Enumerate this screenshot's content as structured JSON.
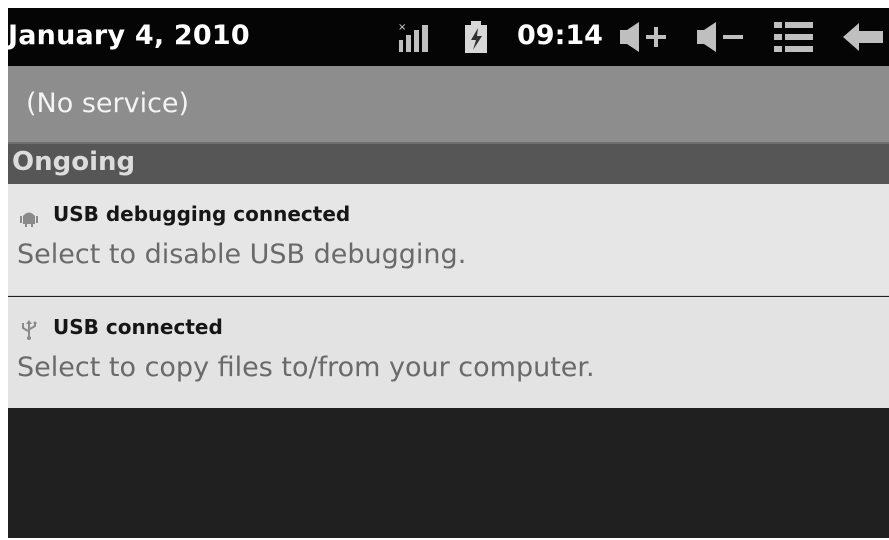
{
  "status_bar": {
    "date": "January 4, 2010",
    "time": "09:14",
    "icons": [
      "signal-icon",
      "battery-icon",
      "volume-up-icon",
      "volume-down-icon",
      "menu-icon",
      "back-icon"
    ]
  },
  "header": {
    "service_text": "(No service)"
  },
  "section": {
    "title": "Ongoing"
  },
  "notifications": [
    {
      "title": "USB debugging connected",
      "body": "Select to disable USB debugging.",
      "icon": "android-debug-icon"
    },
    {
      "title": "USB connected",
      "body": "Select to copy files to/from your computer.",
      "icon": "usb-icon"
    }
  ],
  "colors": {
    "status_bar": "#050505",
    "header": "#8d8d8d",
    "section": "#565656",
    "notification": "#e6e6e6",
    "background": "#1f1f1f"
  }
}
